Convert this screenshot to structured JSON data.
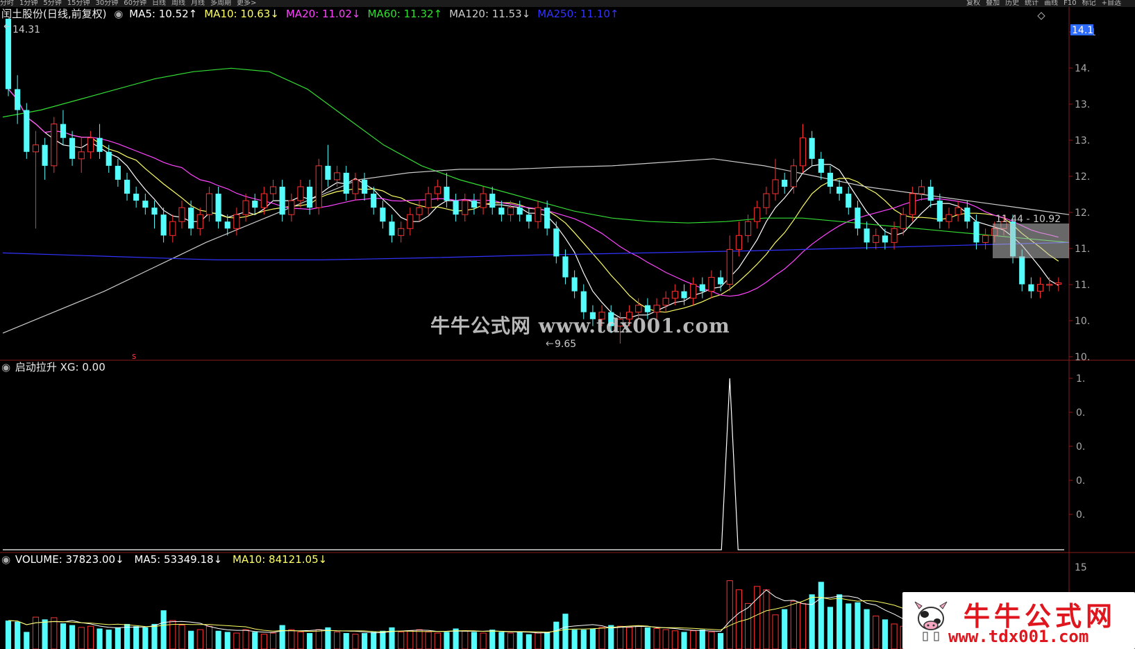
{
  "tabs": [
    "分时",
    "1分钟",
    "5分钟",
    "15分钟",
    "30分钟",
    "60分钟",
    "日线",
    "周线",
    "月线",
    "多周期",
    "更多>"
  ],
  "right_tabs": [
    "复权",
    "叠加",
    "历史",
    "统计",
    "画线",
    "F10",
    "标记",
    "+自选"
  ],
  "main_header": {
    "title": "闰土股份(日线,前复权)",
    "indicators": [
      {
        "label": "MA5: 10.52↑",
        "color": "#ffffff"
      },
      {
        "label": "MA10: 10.63↓",
        "color": "#ffff66"
      },
      {
        "label": "MA20: 11.02↓",
        "color": "#ff44ff"
      },
      {
        "label": "MA60: 11.32↑",
        "color": "#33dd33"
      },
      {
        "label": "MA120: 11.53↓",
        "color": "#cccccc"
      },
      {
        "label": "MA250: 11.10↑",
        "color": "#3333ff"
      }
    ]
  },
  "price_axis": {
    "labels": [
      "14.1",
      "14.",
      "13.",
      "13.",
      "12.",
      "12.",
      "11.",
      "11.",
      "10.",
      "10."
    ],
    "current": "14.1"
  },
  "annotations": {
    "high": "14.31",
    "low": "9.65",
    "range_box": "11.44 - 10.92",
    "marker": "s"
  },
  "indicator_header": "启动拉升  XG: 0.00",
  "indicator_axis": [
    "1.",
    "0.",
    "0.",
    "0.",
    "0."
  ],
  "volume_header": {
    "volume": {
      "label": "VOLUME: 37823.00↓",
      "color": "#ffffff"
    },
    "ma5": {
      "label": "MA5: 53349.18↓",
      "color": "#ffffff"
    },
    "ma10": {
      "label": "MA10: 84121.05↓",
      "color": "#ffff66"
    }
  },
  "volume_axis": [
    "15"
  ],
  "watermark": "牛牛公式网 www.tdx001.com",
  "logo": {
    "title": "牛牛公式网",
    "url": "www.tdx001.com"
  },
  "colors": {
    "up": "#ff3232",
    "down": "#54fcfc",
    "ma250": "#3333ff",
    "ma60": "#33dd33"
  },
  "chart_data": [
    {
      "type": "candlestick",
      "title": "闰土股份(日线,前复权)",
      "ylim": [
        9.5,
        14.3
      ],
      "candles": [
        [
          14.31,
          13.3,
          14.31,
          13.2
        ],
        [
          13.3,
          13.0,
          13.5,
          12.8
        ],
        [
          13.0,
          12.4,
          13.1,
          12.3
        ],
        [
          12.4,
          12.5,
          12.7,
          11.3
        ],
        [
          12.5,
          12.2,
          12.6,
          12.0
        ],
        [
          12.2,
          12.8,
          12.9,
          12.1
        ],
        [
          12.8,
          12.6,
          13.0,
          12.5
        ],
        [
          12.6,
          12.3,
          12.7,
          12.2
        ],
        [
          12.3,
          12.4,
          12.6,
          12.1
        ],
        [
          12.4,
          12.6,
          12.7,
          12.3
        ],
        [
          12.6,
          12.4,
          12.8,
          12.3
        ],
        [
          12.4,
          12.2,
          12.5,
          12.1
        ],
        [
          12.2,
          12.0,
          12.3,
          11.9
        ],
        [
          12.0,
          11.8,
          12.1,
          11.7
        ],
        [
          11.8,
          11.7,
          11.9,
          11.6
        ],
        [
          11.7,
          11.6,
          11.8,
          11.5
        ],
        [
          11.6,
          11.5,
          11.7,
          11.3
        ],
        [
          11.5,
          11.2,
          11.6,
          11.1
        ],
        [
          11.2,
          11.4,
          11.5,
          11.1
        ],
        [
          11.4,
          11.6,
          11.7,
          11.3
        ],
        [
          11.6,
          11.3,
          11.7,
          11.2
        ],
        [
          11.3,
          11.5,
          11.6,
          11.2
        ],
        [
          11.5,
          11.8,
          11.9,
          11.4
        ],
        [
          11.8,
          11.4,
          11.9,
          11.3
        ],
        [
          11.4,
          11.3,
          11.5,
          11.2
        ],
        [
          11.3,
          11.5,
          11.6,
          11.2
        ],
        [
          11.5,
          11.7,
          11.8,
          11.4
        ],
        [
          11.7,
          11.6,
          11.8,
          11.5
        ],
        [
          11.6,
          11.8,
          11.9,
          11.5
        ],
        [
          11.8,
          11.9,
          12.0,
          11.7
        ],
        [
          11.9,
          11.5,
          12.0,
          11.4
        ],
        [
          11.5,
          11.7,
          11.8,
          11.4
        ],
        [
          11.7,
          11.9,
          12.0,
          11.6
        ],
        [
          11.9,
          11.6,
          12.0,
          11.5
        ],
        [
          11.6,
          12.2,
          12.3,
          11.5
        ],
        [
          12.2,
          12.0,
          12.5,
          11.9
        ],
        [
          12.0,
          12.1,
          12.2,
          11.9
        ],
        [
          12.1,
          11.8,
          12.2,
          11.7
        ],
        [
          11.8,
          12.0,
          12.1,
          11.7
        ],
        [
          12.0,
          11.8,
          12.1,
          11.7
        ],
        [
          11.8,
          11.6,
          11.9,
          11.5
        ],
        [
          11.6,
          11.4,
          11.7,
          11.3
        ],
        [
          11.4,
          11.2,
          11.5,
          11.1
        ],
        [
          11.2,
          11.3,
          11.4,
          11.1
        ],
        [
          11.3,
          11.5,
          11.6,
          11.2
        ],
        [
          11.5,
          11.6,
          11.7,
          11.4
        ],
        [
          11.6,
          11.8,
          11.9,
          11.5
        ],
        [
          11.8,
          11.9,
          12.0,
          11.7
        ],
        [
          11.9,
          11.7,
          12.1,
          11.6
        ],
        [
          11.7,
          11.5,
          11.8,
          11.4
        ],
        [
          11.5,
          11.7,
          11.8,
          11.4
        ],
        [
          11.7,
          11.6,
          11.8,
          11.5
        ],
        [
          11.6,
          11.8,
          11.9,
          11.5
        ],
        [
          11.8,
          11.6,
          11.9,
          11.5
        ],
        [
          11.6,
          11.5,
          11.7,
          11.4
        ],
        [
          11.5,
          11.6,
          11.7,
          11.4
        ],
        [
          11.6,
          11.5,
          11.7,
          11.4
        ],
        [
          11.5,
          11.4,
          11.6,
          11.3
        ],
        [
          11.4,
          11.6,
          11.7,
          11.3
        ],
        [
          11.6,
          11.3,
          11.7,
          11.2
        ],
        [
          11.3,
          10.9,
          11.4,
          10.8
        ],
        [
          10.9,
          10.6,
          11.0,
          10.5
        ],
        [
          10.6,
          10.4,
          10.7,
          10.3
        ],
        [
          10.4,
          10.1,
          10.5,
          10.0
        ],
        [
          10.1,
          10.0,
          10.2,
          9.9
        ],
        [
          10.0,
          10.1,
          10.2,
          9.9
        ],
        [
          10.1,
          9.9,
          10.2,
          9.8
        ],
        [
          9.9,
          10.0,
          10.1,
          9.65
        ],
        [
          10.0,
          10.1,
          10.2,
          9.9
        ],
        [
          10.1,
          10.2,
          10.3,
          10.0
        ],
        [
          10.2,
          10.1,
          10.3,
          10.0
        ],
        [
          10.1,
          10.2,
          10.3,
          10.0
        ],
        [
          10.2,
          10.3,
          10.4,
          10.1
        ],
        [
          10.3,
          10.4,
          10.5,
          10.2
        ],
        [
          10.4,
          10.3,
          10.5,
          10.2
        ],
        [
          10.3,
          10.5,
          10.6,
          10.2
        ],
        [
          10.5,
          10.4,
          10.6,
          10.3
        ],
        [
          10.4,
          10.6,
          10.7,
          10.3
        ],
        [
          10.6,
          10.5,
          10.7,
          10.4
        ],
        [
          10.5,
          11.0,
          11.2,
          10.4
        ],
        [
          11.0,
          11.2,
          11.4,
          10.9
        ],
        [
          11.2,
          11.4,
          11.5,
          11.1
        ],
        [
          11.4,
          11.6,
          11.7,
          11.3
        ],
        [
          11.6,
          11.8,
          11.9,
          11.5
        ],
        [
          11.8,
          12.0,
          12.3,
          11.7
        ],
        [
          12.0,
          11.9,
          12.1,
          11.8
        ],
        [
          11.9,
          12.2,
          12.3,
          11.8
        ],
        [
          12.2,
          12.6,
          12.8,
          12.1
        ],
        [
          12.6,
          12.3,
          12.7,
          12.2
        ],
        [
          12.3,
          12.1,
          12.4,
          12.0
        ],
        [
          12.1,
          11.9,
          12.2,
          11.8
        ],
        [
          11.9,
          11.8,
          12.0,
          11.7
        ],
        [
          11.8,
          11.6,
          11.9,
          11.5
        ],
        [
          11.6,
          11.3,
          11.7,
          11.2
        ],
        [
          11.3,
          11.1,
          11.4,
          11.0
        ],
        [
          11.1,
          11.2,
          11.3,
          11.0
        ],
        [
          11.2,
          11.1,
          11.3,
          11.0
        ],
        [
          11.1,
          11.3,
          11.4,
          11.0
        ],
        [
          11.3,
          11.5,
          11.6,
          11.2
        ],
        [
          11.5,
          11.8,
          11.9,
          11.4
        ],
        [
          11.8,
          11.9,
          12.0,
          11.7
        ],
        [
          11.9,
          11.7,
          12.0,
          11.6
        ],
        [
          11.7,
          11.4,
          11.8,
          11.3
        ],
        [
          11.4,
          11.5,
          11.6,
          11.3
        ],
        [
          11.5,
          11.6,
          11.7,
          11.4
        ],
        [
          11.6,
          11.4,
          11.7,
          11.3
        ],
        [
          11.4,
          11.1,
          11.5,
          11.0
        ],
        [
          11.1,
          11.2,
          11.3,
          11.0
        ],
        [
          11.2,
          11.3,
          11.4,
          11.1
        ],
        [
          11.3,
          11.4,
          11.5,
          11.2
        ],
        [
          11.4,
          10.9,
          11.5,
          10.8
        ],
        [
          10.9,
          10.5,
          11.0,
          10.4
        ],
        [
          10.5,
          10.4,
          10.6,
          10.3
        ],
        [
          10.4,
          10.5,
          10.6,
          10.3
        ],
        [
          10.5,
          10.5,
          10.6,
          10.4
        ],
        [
          10.5,
          10.52,
          10.6,
          10.4
        ]
      ],
      "ma": [
        {
          "name": "MA5",
          "color": "#ffffff",
          "values": []
        },
        {
          "name": "MA10",
          "color": "#ffff66",
          "values": []
        },
        {
          "name": "MA20",
          "color": "#ff44ff",
          "values": []
        },
        {
          "name": "MA60",
          "color": "#33dd33",
          "values": [
            12.9,
            13.0,
            13.15,
            13.3,
            13.45,
            13.55,
            13.6,
            13.55,
            13.3,
            12.9,
            12.5,
            12.2,
            12.0,
            11.85,
            11.7,
            11.55,
            11.45,
            11.4,
            11.38,
            11.4,
            11.45,
            11.45,
            11.4,
            11.35,
            11.3,
            11.25,
            11.2,
            11.15,
            11.1
          ]
        },
        {
          "name": "MA120",
          "color": "#cccccc",
          "values": [
            9.8,
            10.1,
            10.4,
            10.75,
            11.1,
            11.4,
            11.7,
            12.0,
            12.1,
            12.15,
            12.15,
            12.18,
            12.2,
            12.25,
            12.3,
            12.2,
            12.05,
            11.9,
            11.8,
            11.7,
            11.6,
            11.5
          ]
        },
        {
          "name": "MA250",
          "color": "#3333ff",
          "values": [
            10.95,
            10.9,
            10.85,
            10.85,
            10.88,
            10.92,
            10.95,
            10.98,
            11.02,
            11.06,
            11.1
          ]
        }
      ]
    },
    {
      "type": "line",
      "title": "启动拉升",
      "ylim": [
        0,
        1
      ],
      "signal_index": 79,
      "values": []
    },
    {
      "type": "bar",
      "title": "VOLUME",
      "values": [
        50000,
        48000,
        30000,
        56000,
        52000,
        55000,
        45000,
        42000,
        38000,
        40000,
        36000,
        34000,
        38000,
        44000,
        40000,
        38000,
        44000,
        68000,
        50000,
        42000,
        32000,
        34000,
        40000,
        32000,
        30000,
        28000,
        34000,
        30000,
        26000,
        28000,
        42000,
        34000,
        30000,
        28000,
        34000,
        38000,
        30000,
        28000,
        26000,
        28000,
        30000,
        32000,
        38000,
        30000,
        32000,
        34000,
        30000,
        28000,
        30000,
        36000,
        32000,
        30000,
        28000,
        34000,
        30000,
        28000,
        30000,
        26000,
        28000,
        30000,
        48000,
        62000,
        34000,
        34000,
        36000,
        38000,
        42000,
        40000,
        38000,
        40000,
        38000,
        36000,
        34000,
        32000,
        30000,
        32000,
        34000,
        30000,
        28000,
        120000,
        104000,
        80000,
        110000,
        104000,
        60000,
        70000,
        84000,
        80000,
        96000,
        118000,
        74000,
        96000,
        80000,
        82000,
        70000,
        58000,
        52000,
        44000,
        40000,
        38000,
        32000,
        34000,
        36000,
        30000,
        28000,
        26000,
        30000,
        28000,
        30000,
        34000,
        40000,
        52000,
        48000,
        44000,
        42000,
        37823
      ]
    }
  ]
}
